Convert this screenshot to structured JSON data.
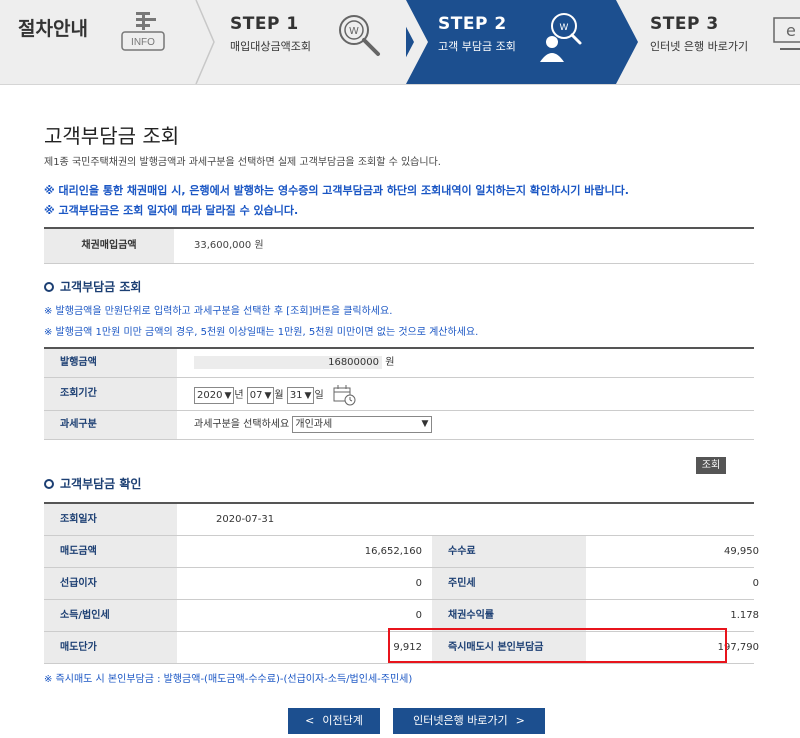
{
  "stepbar": {
    "guide_title": "절차안내",
    "info_label": "INFO",
    "steps": [
      {
        "title": "STEP 1",
        "sub": "매입대상금액조회"
      },
      {
        "title": "STEP 2",
        "sub": "고객 부담금 조회"
      },
      {
        "title": "STEP 3",
        "sub": "인터넷 은행 바로가기"
      }
    ]
  },
  "page": {
    "title": "고객부담금 조회",
    "desc": "제1종 국민주택채권의 발행금액과 과세구분을 선택하면 실제 고객부담금을 조회할 수 있습니다.",
    "notice1": "※ 대리인을 통한 채권매입 시, 은행에서 발행하는 영수증의 고객부담금과 하단의 조회내역이 일치하는지 확인하시기 바랍니다.",
    "notice2": "※ 고객부담금은 조회 일자에 따라 달라질 수 있습니다."
  },
  "purchase": {
    "label": "채권매입금액",
    "value": "33,600,000 원"
  },
  "query_section": {
    "title": "고객부담금 조회",
    "hint1": "※ 발행금액을 만원단위로 입력하고 과세구분을 선택한 후 [조회]버튼을 클릭하세요.",
    "hint2": "※ 발행금액 1만원 미만 금액의 경우, 5천원 이상일때는 1만원, 5천원 미만이면 없는 것으로 계산하세요.",
    "issue_label": "발행금액",
    "issue_value": "16800000",
    "issue_unit": "원",
    "period_label": "조회기간",
    "year": "2020",
    "year_unit": "년",
    "month": "07",
    "month_unit": "월",
    "day": "31",
    "day_unit": "일",
    "tax_label": "과세구분",
    "tax_prompt": "과세구분을 선택하세요",
    "tax_value": "개인과세",
    "query_button": "조회"
  },
  "result_section": {
    "title": "고객부담금 확인",
    "date_label": "조회일자",
    "date_value": "2020-07-31",
    "rows": [
      {
        "l1": "매도금액",
        "v1": "16,652,160",
        "l2": "수수료",
        "v2": "49,950"
      },
      {
        "l1": "선급이자",
        "v1": "0",
        "l2": "주민세",
        "v2": "0"
      },
      {
        "l1": "소득/법인세",
        "v1": "0",
        "l2": "채권수익률",
        "v2": "1.178"
      },
      {
        "l1": "매도단가",
        "v1": "9,912",
        "l2": "즉시매도시 본인부담금",
        "v2": "197,790"
      }
    ],
    "formula": "※ 즉시매도 시 본인부담금 : 발행금액-(매도금액-수수료)-(선급이자-소득/법인세-주민세)"
  },
  "nav": {
    "prev_label": "이전단계",
    "next_label": "인터넷은행 바로가기"
  },
  "colors": {
    "accent": "#1c4f8f",
    "highlight": "#e8141c",
    "notice": "#1a56c4"
  }
}
